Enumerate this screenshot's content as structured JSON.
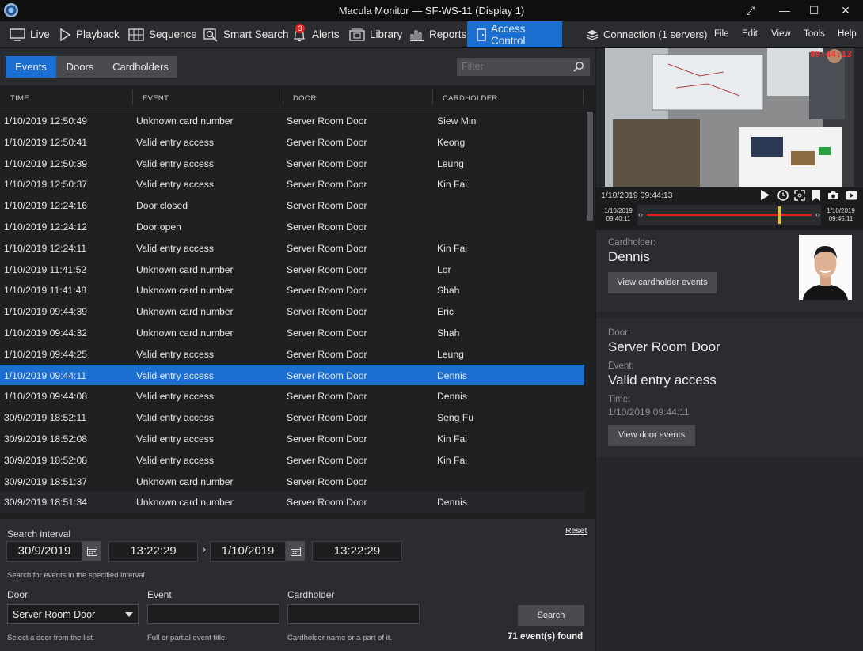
{
  "window": {
    "title": "Macula Monitor — SF-WS-11 (Display 1)",
    "controls": {
      "restore": "⤢",
      "minimize": "—",
      "maximize": "☐",
      "close": "✕"
    }
  },
  "nav": {
    "live": "Live",
    "playback": "Playback",
    "sequence": "Sequence",
    "smart_search": "Smart Search",
    "alerts": "Alerts",
    "alerts_count": "3",
    "library": "Library",
    "reports": "Reports",
    "access_control": "Access Control",
    "connection": "Connection (1 servers)",
    "menu": [
      "File",
      "Edit",
      "View",
      "Tools",
      "Help"
    ]
  },
  "tabs": [
    "Events",
    "Doors",
    "Cardholders"
  ],
  "filter": {
    "placeholder": "Filter"
  },
  "columns": [
    "TIME",
    "EVENT",
    "DOOR",
    "CARDHOLDER"
  ],
  "events": [
    [
      "1/10/2019 12:50:49",
      "Unknown card number",
      "Server Room Door",
      "Siew Min"
    ],
    [
      "1/10/2019 12:50:41",
      "Valid entry access",
      "Server Room Door",
      "Keong"
    ],
    [
      "1/10/2019 12:50:39",
      "Valid entry access",
      "Server Room Door",
      "Leung"
    ],
    [
      "1/10/2019 12:50:37",
      "Valid entry access",
      "Server Room Door",
      "Kin Fai"
    ],
    [
      "1/10/2019 12:24:16",
      "Door closed",
      "Server Room Door",
      ""
    ],
    [
      "1/10/2019 12:24:12",
      "Door open",
      "Server Room Door",
      ""
    ],
    [
      "1/10/2019 12:24:11",
      "Valid entry access",
      "Server Room Door",
      "Kin Fai"
    ],
    [
      "1/10/2019 11:41:52",
      "Unknown card number",
      "Server Room Door",
      "Lor"
    ],
    [
      "1/10/2019 11:41:48",
      "Unknown card number",
      "Server Room Door",
      "Shah"
    ],
    [
      "1/10/2019 09:44:39",
      "Unknown card number",
      "Server Room Door",
      "Eric"
    ],
    [
      "1/10/2019 09:44:32",
      "Unknown card number",
      "Server Room Door",
      "Shah"
    ],
    [
      "1/10/2019 09:44:25",
      "Valid entry access",
      "Server Room Door",
      "Leung"
    ],
    [
      "1/10/2019 09:44:11",
      "Valid entry access",
      "Server Room Door",
      "Dennis"
    ],
    [
      "1/10/2019 09:44:08",
      "Valid entry access",
      "Server Room Door",
      "Dennis"
    ],
    [
      "30/9/2019 18:52:11",
      "Valid entry access",
      "Server Room Door",
      "Seng Fu"
    ],
    [
      "30/9/2019 18:52:08",
      "Valid entry access",
      "Server Room Door",
      "Kin Fai"
    ],
    [
      "30/9/2019 18:52:08",
      "Valid entry access",
      "Server Room Door",
      "Kin Fai"
    ],
    [
      "30/9/2019 18:51:37",
      "Unknown card number",
      "Server Room Door",
      ""
    ],
    [
      "30/9/2019 18:51:34",
      "Unknown card number",
      "Server Room Door",
      "Dennis"
    ]
  ],
  "selected_row": 12,
  "search": {
    "title": "Search interval",
    "reset": "Reset",
    "start_date": "30/9/2019",
    "start_time": "13:22:29",
    "arrow": "›",
    "end_date": "1/10/2019",
    "end_time": "13:22:29",
    "interval_hint": "Search for events in the specified interval.",
    "door_label": "Door",
    "door_value": "Server Room Door",
    "door_hint": "Select a door from the list.",
    "event_label": "Event",
    "event_value": "",
    "event_hint": "Full or partial event title.",
    "cardholder_label": "Cardholder",
    "cardholder_value": "",
    "cardholder_hint": "Cardholder name or a part of it.",
    "search_button": "Search",
    "found": "71 event(s) found"
  },
  "video": {
    "overlay_time": "09:44:13",
    "current_time": "1/10/2019 09:44:13",
    "tl_start_date": "1/10/2019",
    "tl_start_time": "09:40:11",
    "tl_end_date": "1/10/2019",
    "tl_end_time": "09:45:11",
    "playhead_fraction": 0.77
  },
  "cardholder": {
    "label": "Cardholder:",
    "name": "Dennis",
    "button": "View cardholder events"
  },
  "details": {
    "door_label": "Door:",
    "door": "Server Room Door",
    "event_label": "Event:",
    "event": "Valid entry access",
    "time_label": "Time:",
    "time": "1/10/2019 09:44:11",
    "button": "View door events"
  },
  "colors": {
    "accent": "#1a6fd1",
    "timeline": "#e02020",
    "playhead": "#f0c020"
  }
}
